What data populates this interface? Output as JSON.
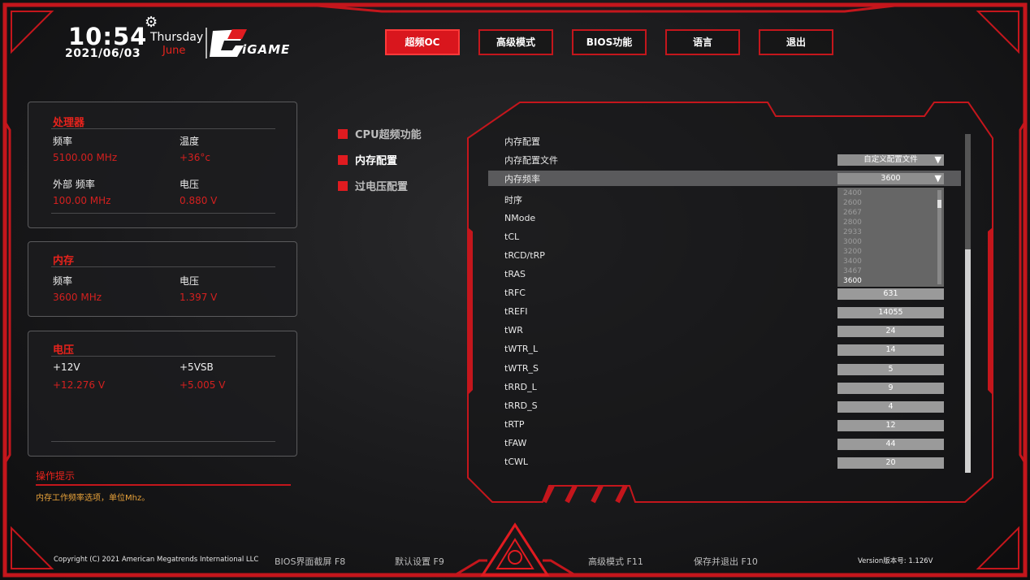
{
  "clock": {
    "time": "10:54",
    "date": "2021/06/03",
    "weekday": "Thursday",
    "month": "June"
  },
  "logo": {
    "text": "iGAME"
  },
  "nav": [
    {
      "label": "超频OC",
      "active": true
    },
    {
      "label": "高级模式",
      "active": false
    },
    {
      "label": "BIOS功能",
      "active": false
    },
    {
      "label": "语言",
      "active": false
    },
    {
      "label": "退出",
      "active": false
    }
  ],
  "cpu_panel": {
    "title": "处理器",
    "freq_label": "频率",
    "freq_value": "5100.00 MHz",
    "temp_label": "温度",
    "temp_value": "+36°c",
    "ext_freq_label": "外部 频率",
    "ext_freq_value": "100.00 MHz",
    "volt_label": "电压",
    "volt_value": "0.880 V"
  },
  "mem_panel": {
    "title": "内存",
    "freq_label": "频率",
    "freq_value": "3600 MHz",
    "volt_label": "电压",
    "volt_value": "1.397 V"
  },
  "volt_panel": {
    "title": "电压",
    "v12_label": "+12V",
    "v12_value": "+12.276 V",
    "v5_label": "+5VSB",
    "v5_value": "+5.005 V"
  },
  "menu": [
    {
      "label": "CPU超频功能",
      "active": false
    },
    {
      "label": "内存配置",
      "active": true
    },
    {
      "label": "过电压配置",
      "active": false
    }
  ],
  "config": {
    "section": "内存配置",
    "profile_label": "内存配置文件",
    "profile_value": "自定义配置文件",
    "freq_label": "内存频率",
    "freq_value": "3600",
    "timing_label": "时序",
    "options": [
      "2400",
      "2600",
      "2667",
      "2800",
      "2933",
      "3000",
      "3200",
      "3400",
      "3467",
      "3600"
    ],
    "selected_option": "3600",
    "rows": [
      {
        "label": "NMode",
        "value": ""
      },
      {
        "label": "tCL",
        "value": ""
      },
      {
        "label": "tRCD/tRP",
        "value": ""
      },
      {
        "label": "tRAS",
        "value": ""
      },
      {
        "label": "tRFC",
        "value": "631"
      },
      {
        "label": "tREFI",
        "value": "14055"
      },
      {
        "label": "tWR",
        "value": "24"
      },
      {
        "label": "tWTR_L",
        "value": "14"
      },
      {
        "label": "tWTR_S",
        "value": "5"
      },
      {
        "label": "tRRD_L",
        "value": "9"
      },
      {
        "label": "tRRD_S",
        "value": "4"
      },
      {
        "label": "tRTP",
        "value": "12"
      },
      {
        "label": "tFAW",
        "value": "44"
      },
      {
        "label": "tCWL",
        "value": "20"
      }
    ]
  },
  "hint": {
    "title": "操作提示",
    "text": "内存工作频率选项，单位Mhz。"
  },
  "footer": {
    "copyright": "Copyright (C) 2021 American Megatrends International LLC",
    "screenshot": "BIOS界面截屏 F8",
    "defaults": "默认设置 F9",
    "advanced": "高级模式 F11",
    "save_exit": "保存并退出 F10",
    "version": "Version版本号: 1.126V"
  },
  "colors": {
    "accent": "#e01b20",
    "background": "#1c1c1e",
    "field": "#9a9a9a"
  }
}
